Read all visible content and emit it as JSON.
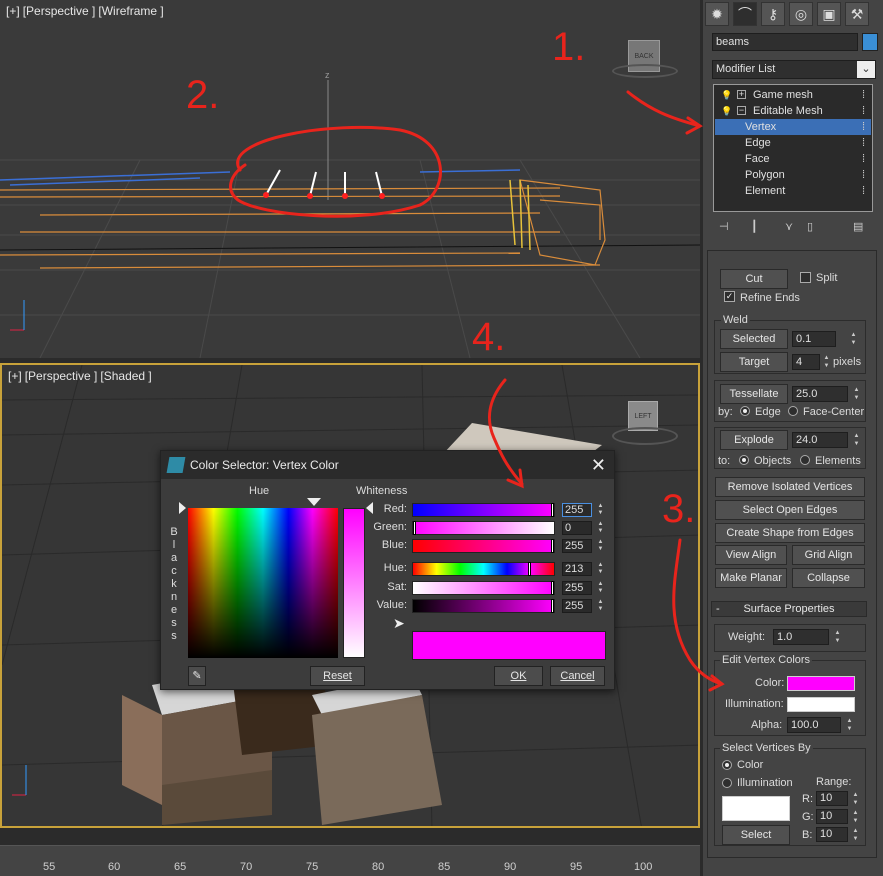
{
  "viewport_top": {
    "labels": [
      "[+]",
      "[Perspective ]",
      "[Wireframe ]"
    ],
    "axis_label": "z"
  },
  "viewport_bottom": {
    "labels": [
      "[+]",
      "[Perspective ]",
      "[Shaded ]"
    ]
  },
  "viewcube": {
    "top_face": "BACK",
    "bottom_face": "LEFT"
  },
  "timeline": {
    "ticks": [
      "55",
      "60",
      "65",
      "70",
      "75",
      "80",
      "85",
      "90",
      "95",
      "100"
    ]
  },
  "panel": {
    "object_name": "beams",
    "object_color": "#3a8fd6",
    "modifier_list": "Modifier List",
    "stack": {
      "items": [
        {
          "label": "Game mesh",
          "level": 0,
          "prefix": "+"
        },
        {
          "label": "Editable Mesh",
          "level": 0,
          "prefix": "−"
        },
        {
          "label": "Vertex",
          "level": 1,
          "selected": true
        },
        {
          "label": "Edge",
          "level": 1
        },
        {
          "label": "Face",
          "level": 1
        },
        {
          "label": "Polygon",
          "level": 1
        },
        {
          "label": "Element",
          "level": 1
        }
      ]
    },
    "edit": {
      "cut": "Cut",
      "split": "Split",
      "refine_ends": "Refine Ends",
      "weld_title": "Weld",
      "selected": "Selected",
      "selected_value": "0.1",
      "target": "Target",
      "target_value": "4",
      "pixels": "pixels",
      "tessellate": "Tessellate",
      "tessellate_value": "25.0",
      "by": "by:",
      "edge": "Edge",
      "face_center": "Face-Center",
      "explode": "Explode",
      "explode_value": "24.0",
      "to": "to:",
      "objects": "Objects",
      "elements": "Elements",
      "remove_isolated": "Remove Isolated Vertices",
      "select_open_edges": "Select Open Edges",
      "create_shape": "Create Shape from Edges",
      "view_align": "View Align",
      "grid_align": "Grid Align",
      "make_planar": "Make Planar",
      "collapse": "Collapse"
    },
    "surface": {
      "title": "Surface Properties",
      "toggle": "-",
      "weight_label": "Weight:",
      "weight_value": "1.0",
      "edit_vertex_colors": "Edit Vertex Colors",
      "color_label": "Color:",
      "color_value": "#ff00ff",
      "illumination_label": "Illumination:",
      "illumination_value": "#ffffff",
      "alpha_label": "Alpha:",
      "alpha_value": "100.0",
      "select_by_title": "Select Vertices By",
      "opt_color": "Color",
      "opt_illumination": "Illumination",
      "range_label": "Range:",
      "r_label": "R:",
      "r_value": "10",
      "g_label": "G:",
      "g_value": "10",
      "b_label": "B:",
      "b_value": "10",
      "select_button": "Select",
      "select_swatch": "#ffffff"
    }
  },
  "dialog": {
    "title": "Color Selector: Vertex Color",
    "hue_label": "Hue",
    "whiteness_label": "Whiteness",
    "blackness_letters": [
      "B",
      "l",
      "a",
      "c",
      "k",
      "n",
      "e",
      "s",
      "s"
    ],
    "rows": [
      {
        "label": "Red:",
        "value": "255",
        "level": 1.0
      },
      {
        "label": "Green:",
        "value": "0",
        "level": 0.0
      },
      {
        "label": "Blue:",
        "value": "255",
        "level": 1.0
      },
      {
        "label": "Hue:",
        "value": "213",
        "level": 0.835
      },
      {
        "label": "Sat:",
        "value": "255",
        "level": 1.0
      },
      {
        "label": "Value:",
        "value": "255",
        "level": 1.0
      }
    ],
    "preview_color": "#ff00ff",
    "reset": "Reset",
    "ok": "OK",
    "cancel": "Cancel"
  },
  "annotations": {
    "color": "#e8241c",
    "numbers": [
      "1.",
      "2.",
      "3.",
      "4."
    ]
  }
}
